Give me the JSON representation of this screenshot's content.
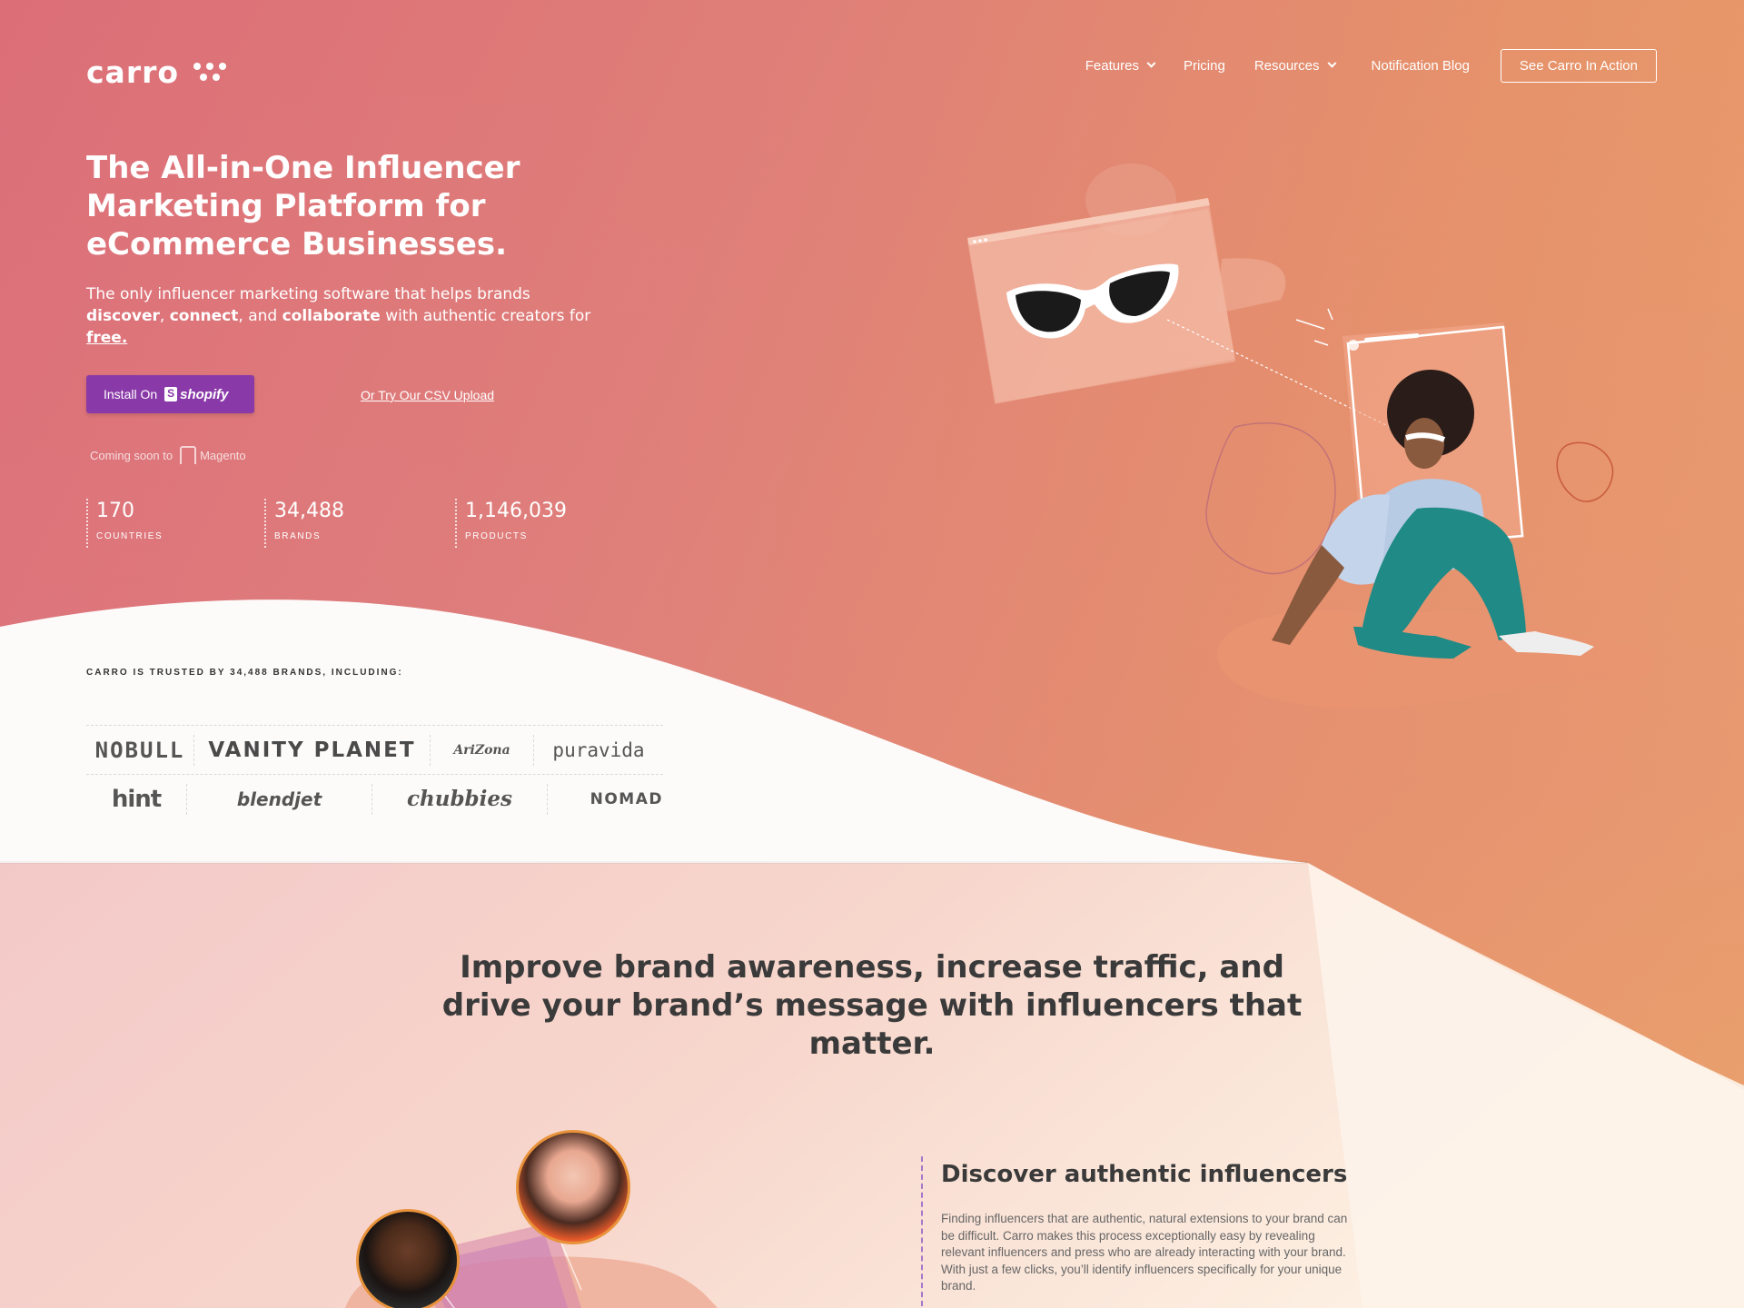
{
  "brand": {
    "logo_text": "carro"
  },
  "nav": {
    "items": [
      {
        "label": "Features",
        "dropdown": true
      },
      {
        "label": "Pricing",
        "dropdown": false
      },
      {
        "label": "Resources",
        "dropdown": true
      },
      {
        "label": "Notification Blog",
        "dropdown": false
      }
    ],
    "cta_label": "See Carro In Action"
  },
  "hero": {
    "title": "The All-in-One Influencer Marketing Platform for eCommerce Businesses.",
    "subtitle_parts": {
      "p1": "The only influencer marketing software that helps brands ",
      "b1": "discover",
      "p2": ", ",
      "b2": "connect",
      "p3": ", and ",
      "b3": "collaborate",
      "p4": " with authentic creators for ",
      "b4": "free."
    },
    "install_label": "Install On",
    "shopify_label": "shopify",
    "csv_link": "Or Try Our CSV Upload",
    "coming_soon": "Coming soon to",
    "magento_label": "Magento",
    "stats": [
      {
        "value": "170",
        "label": "COUNTRIES"
      },
      {
        "value": "34,488",
        "label": "BRANDS"
      },
      {
        "value": "1,146,039",
        "label": "PRODUCTS"
      }
    ]
  },
  "trusted": {
    "label": "CARRO IS TRUSTED BY 34,488 BRANDS, INCLUDING:",
    "brands_row1": [
      "NOBULL",
      "VANITY PLANET",
      "AriZona",
      "puravida"
    ],
    "brands_row2": [
      "hint",
      "blendjet",
      "chubbies",
      "NOMAD"
    ]
  },
  "section": {
    "title": "Improve brand awareness, increase traffic, and drive your brand’s message with influencers that matter.",
    "discover_title": "Discover authentic influencers",
    "discover_text": "Finding influencers that are authentic, natural extensions to your brand can be difficult. Carro makes this process exceptionally easy by revealing relevant influencers and press who are already interacting with your brand. With just a few clicks, you’ll identify influencers specifically for your unique brand."
  },
  "colors": {
    "accent_purple": "#8a3aa8",
    "hero_start": "#dc6e78",
    "hero_end": "#eba46a",
    "avatar_ring": "#e8923a"
  }
}
